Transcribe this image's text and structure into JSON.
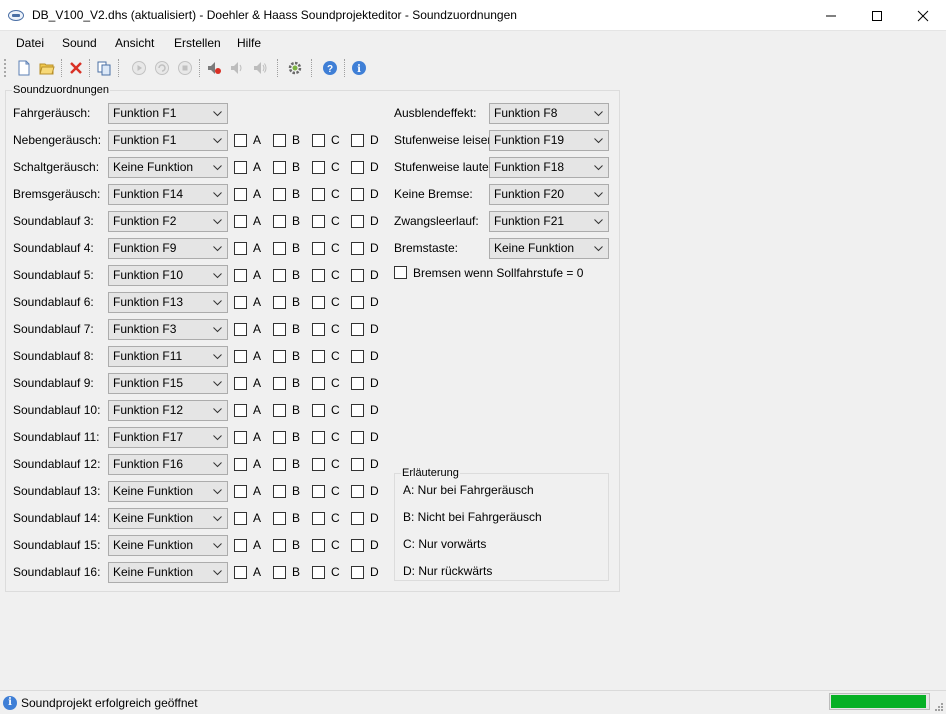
{
  "window": {
    "title": "DB_V100_V2.dhs (aktualisiert) - Doehler & Haass Soundprojekteditor - Soundzuordnungen"
  },
  "menu": [
    "Datei",
    "Sound",
    "Ansicht",
    "Erstellen",
    "Hilfe"
  ],
  "toolbar": {
    "icons": [
      "new-file-icon",
      "open-folder-icon",
      "delete-icon",
      "copy-icon",
      "play-icon",
      "loop-icon",
      "stop-icon",
      "speaker-mute-icon",
      "speaker-icon",
      "speaker-volume-icon",
      "gear-icon",
      "help-icon",
      "info-icon"
    ]
  },
  "group": {
    "title": "Soundzuordnungen",
    "checkbox_letters": [
      "A",
      "B",
      "C",
      "D"
    ],
    "rows": [
      {
        "label": "Fahrgeräusch:",
        "value": "Funktion F1",
        "has_checks": false
      },
      {
        "label": "Nebengeräusch:",
        "value": "Funktion F1",
        "has_checks": true
      },
      {
        "label": "Schaltgeräusch:",
        "value": "Keine Funktion",
        "has_checks": true
      },
      {
        "label": "Bremsgeräusch:",
        "value": "Funktion F14",
        "has_checks": true
      },
      {
        "label": "Soundablauf 3:",
        "value": "Funktion F2",
        "has_checks": true
      },
      {
        "label": "Soundablauf 4:",
        "value": "Funktion F9",
        "has_checks": true
      },
      {
        "label": "Soundablauf 5:",
        "value": "Funktion F10",
        "has_checks": true
      },
      {
        "label": "Soundablauf 6:",
        "value": "Funktion F13",
        "has_checks": true
      },
      {
        "label": "Soundablauf 7:",
        "value": "Funktion F3",
        "has_checks": true
      },
      {
        "label": "Soundablauf 8:",
        "value": "Funktion F11",
        "has_checks": true
      },
      {
        "label": "Soundablauf 9:",
        "value": "Funktion F15",
        "has_checks": true
      },
      {
        "label": "Soundablauf 10:",
        "value": "Funktion F12",
        "has_checks": true
      },
      {
        "label": "Soundablauf 11:",
        "value": "Funktion F17",
        "has_checks": true
      },
      {
        "label": "Soundablauf 12:",
        "value": "Funktion F16",
        "has_checks": true
      },
      {
        "label": "Soundablauf 13:",
        "value": "Keine Funktion",
        "has_checks": true
      },
      {
        "label": "Soundablauf 14:",
        "value": "Keine Funktion",
        "has_checks": true
      },
      {
        "label": "Soundablauf 15:",
        "value": "Keine Funktion",
        "has_checks": true
      },
      {
        "label": "Soundablauf 16:",
        "value": "Keine Funktion",
        "has_checks": true
      }
    ],
    "right_rows": [
      {
        "label": "Ausblendeffekt:",
        "value": "Funktion F8"
      },
      {
        "label": "Stufenweise leiser:",
        "value": "Funktion F19"
      },
      {
        "label": "Stufenweise lauter:",
        "value": "Funktion F18"
      },
      {
        "label": "Keine Bremse:",
        "value": "Funktion F20"
      },
      {
        "label": "Zwangsleerlauf:",
        "value": "Funktion F21"
      },
      {
        "label": "Bremstaste:",
        "value": "Keine Funktion"
      }
    ],
    "brake_checkbox_label": "Bremsen wenn Sollfahrstufe = 0",
    "explanation": {
      "title": "Erläuterung",
      "lines": [
        "A: Nur bei Fahrgeräusch",
        "B: Nicht bei Fahrgeräusch",
        "C: Nur vorwärts",
        "D: Nur rückwärts"
      ]
    }
  },
  "status": {
    "text": "Soundprojekt erfolgreich geöffnet",
    "progress_fraction": 0.98,
    "progress_color": "#06b025"
  }
}
